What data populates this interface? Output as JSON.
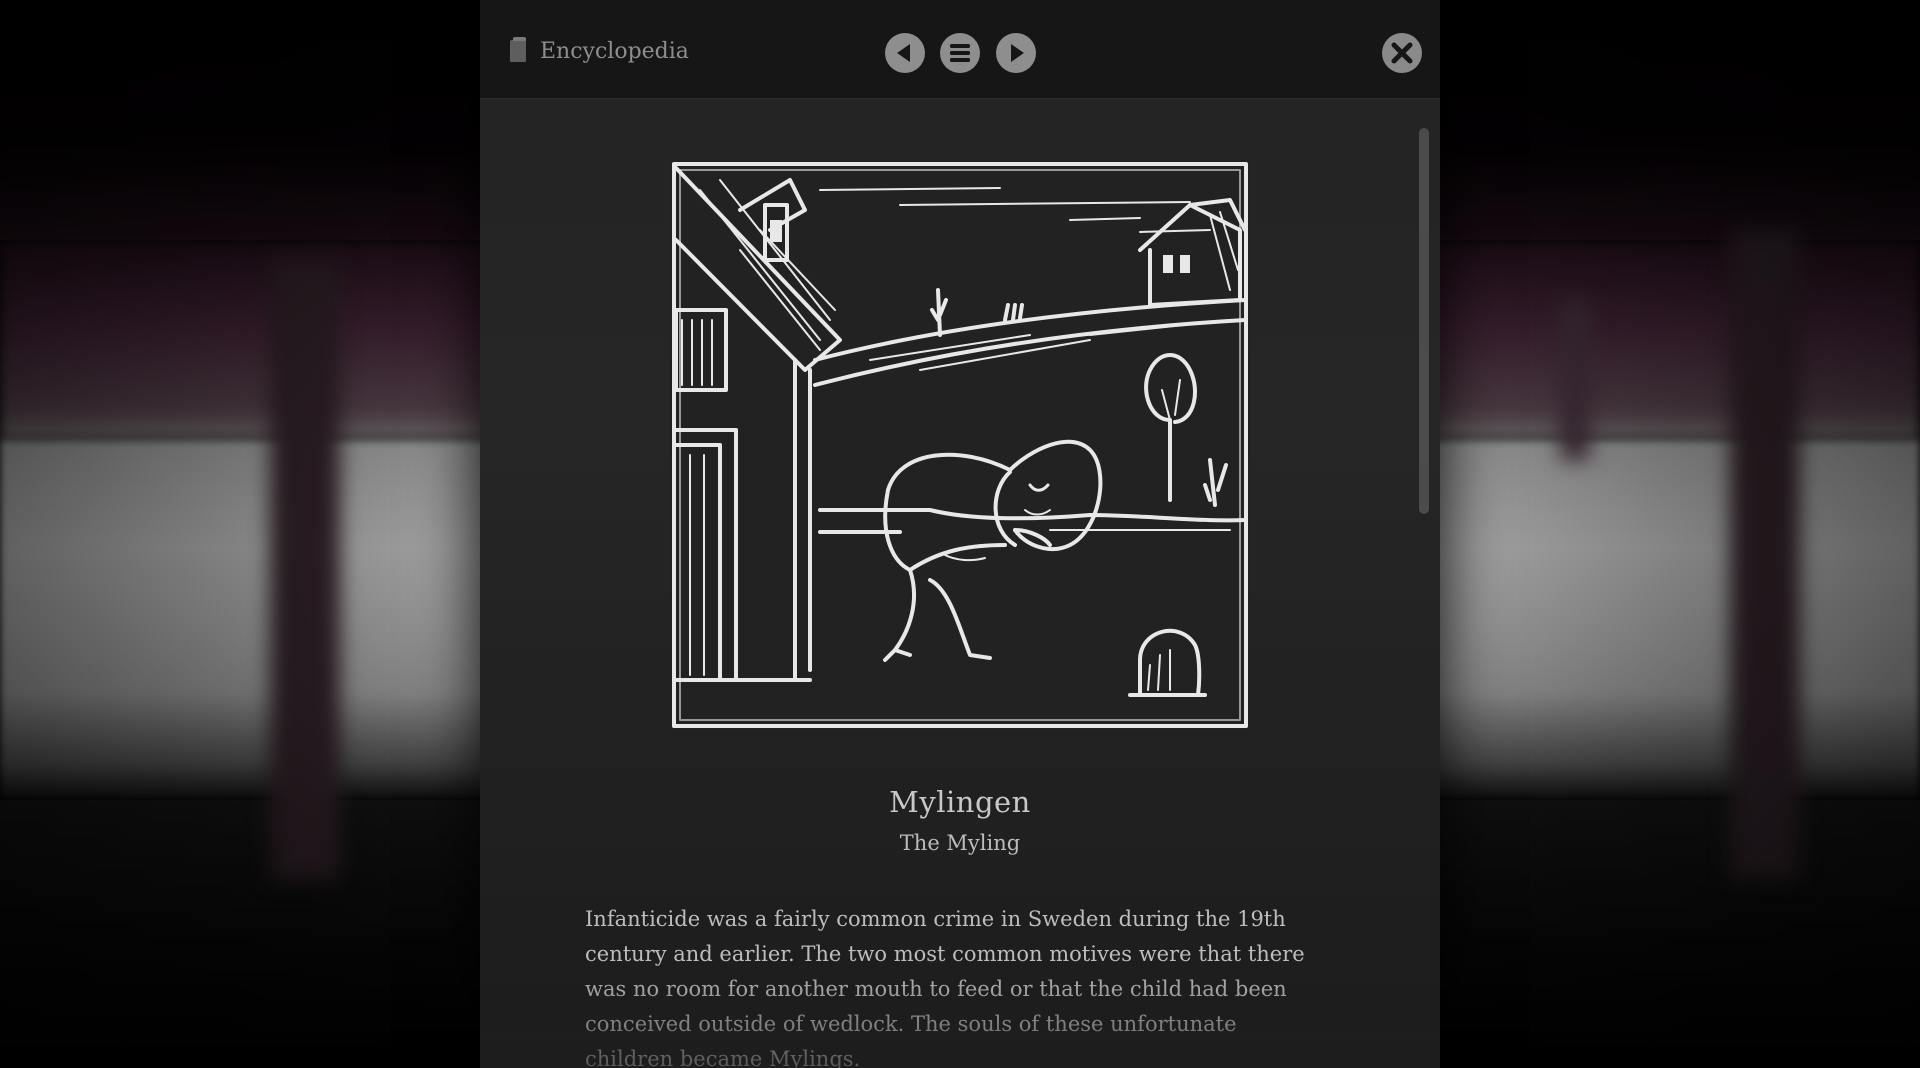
{
  "header": {
    "title": "Encyclopedia",
    "icons": {
      "book": "book-icon",
      "previous": "previous-arrow-icon",
      "menu": "menu-icon",
      "next": "next-arrow-icon",
      "close": "close-icon"
    }
  },
  "entry": {
    "title": "Mylingen",
    "subtitle": "The Myling",
    "body": "Infanticide was a fairly common crime in Sweden during the 19th century and earlier. The two most common motives were that there was no room for another mouth to feed or that the child had been conceived outside of wedlock. The souls of these unfortunate children became Mylings."
  },
  "colors": {
    "panel": "#242424",
    "topbar": "#161616",
    "button": "#8e8e8e",
    "text": "#bdbdbd"
  }
}
